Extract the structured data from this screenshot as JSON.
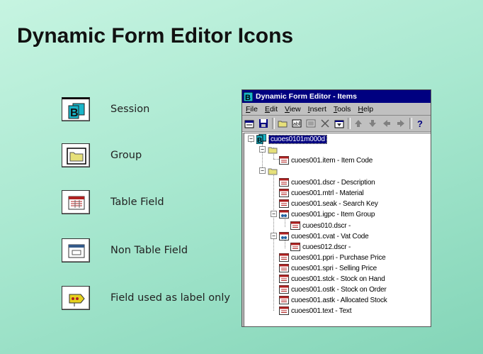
{
  "slide": {
    "title": "Dynamic Form Editor Icons"
  },
  "legend": [
    {
      "label": "Session",
      "icon": "session-icon"
    },
    {
      "label": "Group",
      "icon": "group-folder-icon"
    },
    {
      "label": "Table Field",
      "icon": "table-field-icon"
    },
    {
      "label": "Non Table Field",
      "icon": "non-table-field-icon"
    },
    {
      "label": "Field used as label only",
      "icon": "label-only-field-icon"
    }
  ],
  "window": {
    "title": "Dynamic Form Editor - Items",
    "menu": [
      {
        "label": "File",
        "key": "F",
        "rest": "ile"
      },
      {
        "label": "Edit",
        "key": "E",
        "rest": "dit"
      },
      {
        "label": "View",
        "key": "V",
        "rest": "iew"
      },
      {
        "label": "Insert",
        "key": "I",
        "rest": "nsert"
      },
      {
        "label": "Tools",
        "key": "T",
        "rest": "ools"
      },
      {
        "label": "Help",
        "key": "H",
        "rest": "elp"
      }
    ],
    "toolbar": [
      "new-form-icon",
      "save-icon",
      "separator",
      "folder-icon",
      "text-field-icon",
      "image-icon",
      "delete-icon",
      "properties-icon",
      "separator",
      "move-up-icon",
      "move-down-icon",
      "move-left-icon",
      "move-right-icon",
      "separator",
      "help-icon"
    ],
    "tree": [
      {
        "text": "cuoes0101m000d",
        "icon": "session",
        "selected": true
      },
      {
        "text": "",
        "icon": "folder"
      },
      {
        "text": "cuoes001.item - Item Code",
        "icon": "table-field"
      },
      {
        "text": "",
        "icon": "folder"
      },
      {
        "text": "cuoes001.dscr - Description",
        "icon": "table-field"
      },
      {
        "text": "cuoes001.mtrl - Material",
        "icon": "table-field"
      },
      {
        "text": "cuoes001.seak - Search Key",
        "icon": "table-field"
      },
      {
        "text": "cuoes001.igpc - Item Group",
        "icon": "table-field-ref"
      },
      {
        "text": "cuoes010.dscr -",
        "icon": "table-field"
      },
      {
        "text": "cuoes001.cvat - Vat Code",
        "icon": "table-field-ref"
      },
      {
        "text": "cuoes012.dscr -",
        "icon": "table-field"
      },
      {
        "text": "cuoes001.ppri - Purchase Price",
        "icon": "table-field"
      },
      {
        "text": "cuoes001.spri - Selling Price",
        "icon": "table-field"
      },
      {
        "text": "cuoes001.stck - Stock on Hand",
        "icon": "table-field"
      },
      {
        "text": "cuoes001.ostk - Stock on Order",
        "icon": "table-field"
      },
      {
        "text": "cuoes001.astk - Allocated Stock",
        "icon": "table-field"
      },
      {
        "text": "cuoes001.text - Text",
        "icon": "table-field"
      }
    ]
  }
}
